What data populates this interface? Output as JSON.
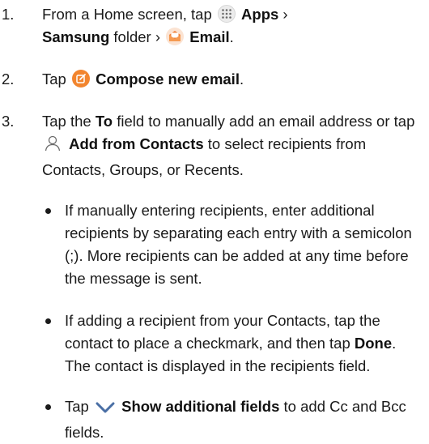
{
  "steps": [
    {
      "number": "1.",
      "parts": {
        "t1": "From a Home screen, tap",
        "apps_label": "Apps",
        "sep1": "›",
        "samsung_label": "Samsung",
        "t2": "folder ›",
        "email_label": "Email",
        "t3": "."
      }
    },
    {
      "number": "2.",
      "parts": {
        "t1": "Tap",
        "compose_label": "Compose new email",
        "t2": "."
      }
    },
    {
      "number": "3.",
      "parts": {
        "t1": "Tap the",
        "to_label": "To",
        "t2": "field to manually add an email address or tap",
        "contacts_label": "Add from Contacts",
        "t3": "to select recipients from Contacts, Groups, or Recents."
      }
    }
  ],
  "bullets": [
    {
      "text": "If manually entering recipients, enter additional recipients by separating each entry with a semicolon (;). More recipients can be added at any time before the message is sent."
    },
    {
      "t1": "If adding a recipient from your Contacts, tap the contact to place a checkmark, and then tap",
      "done_label": "Done",
      "t2": ". The contact is displayed in the recipients field."
    },
    {
      "t1": "Tap",
      "show_label": "Show additional fields",
      "t2": "to add Cc and Bcc fields."
    }
  ],
  "icons": {
    "apps": "apps-grid-icon",
    "email": "email-app-icon",
    "compose": "compose-icon",
    "contacts": "add-contact-icon",
    "chevron": "chevron-down-icon"
  },
  "colors": {
    "compose_orange": "#f2852e",
    "email_orange": "#f0813a",
    "chevron_blue": "#4a6fa5"
  }
}
